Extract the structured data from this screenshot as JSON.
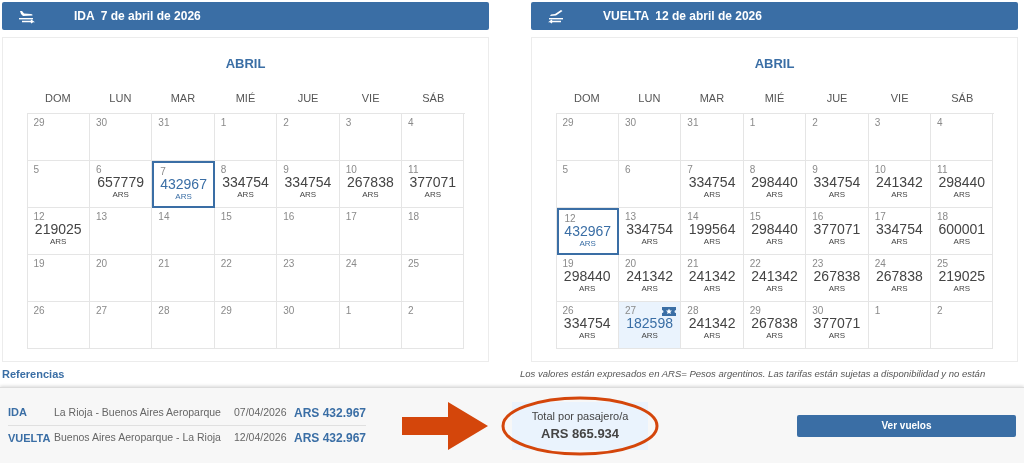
{
  "trips": [
    {
      "kind": "outbound",
      "label": "IDA",
      "date": "7 de abril de 2026",
      "month": "ABRIL",
      "weekdays": [
        "DOM",
        "LUN",
        "MAR",
        "MIÉ",
        "JUE",
        "VIE",
        "SÁB"
      ],
      "weeks": [
        [
          {
            "day": "29",
            "selected": false,
            "best": false
          },
          {
            "day": "30",
            "selected": false,
            "best": false
          },
          {
            "day": "31",
            "selected": false,
            "best": false
          },
          {
            "day": "1",
            "selected": false,
            "best": false
          },
          {
            "day": "2",
            "selected": false,
            "best": false
          },
          {
            "day": "3",
            "selected": false,
            "best": false
          },
          {
            "day": "4",
            "selected": false,
            "best": false
          }
        ],
        [
          {
            "day": "5",
            "selected": false,
            "best": false
          },
          {
            "day": "6",
            "price": "657779",
            "currency": "ARS",
            "selected": false,
            "best": false
          },
          {
            "day": "7",
            "price": "432967",
            "currency": "ARS",
            "selected": true,
            "best": false
          },
          {
            "day": "8",
            "price": "334754",
            "currency": "ARS",
            "selected": false,
            "best": false
          },
          {
            "day": "9",
            "price": "334754",
            "currency": "ARS",
            "selected": false,
            "best": false
          },
          {
            "day": "10",
            "price": "267838",
            "currency": "ARS",
            "selected": false,
            "best": false
          },
          {
            "day": "11",
            "price": "377071",
            "currency": "ARS",
            "selected": false,
            "best": false
          }
        ],
        [
          {
            "day": "12",
            "price": "219025",
            "currency": "ARS",
            "selected": false,
            "best": false
          },
          {
            "day": "13",
            "selected": false,
            "best": false
          },
          {
            "day": "14",
            "selected": false,
            "best": false
          },
          {
            "day": "15",
            "selected": false,
            "best": false
          },
          {
            "day": "16",
            "selected": false,
            "best": false
          },
          {
            "day": "17",
            "selected": false,
            "best": false
          },
          {
            "day": "18",
            "selected": false,
            "best": false
          }
        ],
        [
          {
            "day": "19",
            "selected": false,
            "best": false
          },
          {
            "day": "20",
            "selected": false,
            "best": false
          },
          {
            "day": "21",
            "selected": false,
            "best": false
          },
          {
            "day": "22",
            "selected": false,
            "best": false
          },
          {
            "day": "23",
            "selected": false,
            "best": false
          },
          {
            "day": "24",
            "selected": false,
            "best": false
          },
          {
            "day": "25",
            "selected": false,
            "best": false
          }
        ],
        [
          {
            "day": "26",
            "selected": false,
            "best": false
          },
          {
            "day": "27",
            "selected": false,
            "best": false
          },
          {
            "day": "28",
            "selected": false,
            "best": false
          },
          {
            "day": "29",
            "selected": false,
            "best": false
          },
          {
            "day": "30",
            "selected": false,
            "best": false
          },
          {
            "day": "1",
            "selected": false,
            "best": false
          },
          {
            "day": "2",
            "selected": false,
            "best": false
          }
        ]
      ]
    },
    {
      "kind": "return",
      "label": "VUELTA",
      "date": "12 de abril de 2026",
      "month": "ABRIL",
      "weekdays": [
        "DOM",
        "LUN",
        "MAR",
        "MIÉ",
        "JUE",
        "VIE",
        "SÁB"
      ],
      "weeks": [
        [
          {
            "day": "29",
            "selected": false,
            "best": false
          },
          {
            "day": "30",
            "selected": false,
            "best": false
          },
          {
            "day": "31",
            "selected": false,
            "best": false
          },
          {
            "day": "1",
            "selected": false,
            "best": false
          },
          {
            "day": "2",
            "selected": false,
            "best": false
          },
          {
            "day": "3",
            "selected": false,
            "best": false
          },
          {
            "day": "4",
            "selected": false,
            "best": false
          }
        ],
        [
          {
            "day": "5",
            "selected": false,
            "best": false
          },
          {
            "day": "6",
            "selected": false,
            "best": false
          },
          {
            "day": "7",
            "price": "334754",
            "currency": "ARS",
            "selected": false,
            "best": false
          },
          {
            "day": "8",
            "price": "298440",
            "currency": "ARS",
            "selected": false,
            "best": false
          },
          {
            "day": "9",
            "price": "334754",
            "currency": "ARS",
            "selected": false,
            "best": false
          },
          {
            "day": "10",
            "price": "241342",
            "currency": "ARS",
            "selected": false,
            "best": false
          },
          {
            "day": "11",
            "price": "298440",
            "currency": "ARS",
            "selected": false,
            "best": false
          }
        ],
        [
          {
            "day": "12",
            "price": "432967",
            "currency": "ARS",
            "selected": true,
            "best": false
          },
          {
            "day": "13",
            "price": "334754",
            "currency": "ARS",
            "selected": false,
            "best": false
          },
          {
            "day": "14",
            "price": "199564",
            "currency": "ARS",
            "selected": false,
            "best": false
          },
          {
            "day": "15",
            "price": "298440",
            "currency": "ARS",
            "selected": false,
            "best": false
          },
          {
            "day": "16",
            "price": "377071",
            "currency": "ARS",
            "selected": false,
            "best": false
          },
          {
            "day": "17",
            "price": "334754",
            "currency": "ARS",
            "selected": false,
            "best": false
          },
          {
            "day": "18",
            "price": "600001",
            "currency": "ARS",
            "selected": false,
            "best": false
          }
        ],
        [
          {
            "day": "19",
            "price": "298440",
            "currency": "ARS",
            "selected": false,
            "best": false
          },
          {
            "day": "20",
            "price": "241342",
            "currency": "ARS",
            "selected": false,
            "best": false
          },
          {
            "day": "21",
            "price": "241342",
            "currency": "ARS",
            "selected": false,
            "best": false
          },
          {
            "day": "22",
            "price": "241342",
            "currency": "ARS",
            "selected": false,
            "best": false
          },
          {
            "day": "23",
            "price": "267838",
            "currency": "ARS",
            "selected": false,
            "best": false
          },
          {
            "day": "24",
            "price": "267838",
            "currency": "ARS",
            "selected": false,
            "best": false
          },
          {
            "day": "25",
            "price": "219025",
            "currency": "ARS",
            "selected": false,
            "best": false
          }
        ],
        [
          {
            "day": "26",
            "price": "334754",
            "currency": "ARS",
            "selected": false,
            "best": false
          },
          {
            "day": "27",
            "price": "182598",
            "currency": "ARS",
            "selected": false,
            "best": true
          },
          {
            "day": "28",
            "price": "241342",
            "currency": "ARS",
            "selected": false,
            "best": false
          },
          {
            "day": "29",
            "price": "267838",
            "currency": "ARS",
            "selected": false,
            "best": false
          },
          {
            "day": "30",
            "price": "377071",
            "currency": "ARS",
            "selected": false,
            "best": false
          },
          {
            "day": "1",
            "selected": false,
            "best": false
          },
          {
            "day": "2",
            "selected": false,
            "best": false
          }
        ]
      ]
    }
  ],
  "legend_title": "Referencias",
  "disclaimer": "Los valores están expresados en ARS= Pesos argentinos. Las tarifas están sujetas a disponibilidad y no están",
  "summary": {
    "legs": [
      {
        "label": "IDA",
        "route": "La Rioja - Buenos Aires Aeroparque",
        "date": "07/04/2026",
        "price": "ARS 432.967"
      },
      {
        "label": "VUELTA",
        "route": "Buenos Aires Aeroparque - La Rioja",
        "date": "12/04/2026",
        "price": "ARS 432.967"
      }
    ],
    "total_label": "Total por pasajero/a",
    "total": "ARS 865.934",
    "button": "Ver vuelos"
  }
}
